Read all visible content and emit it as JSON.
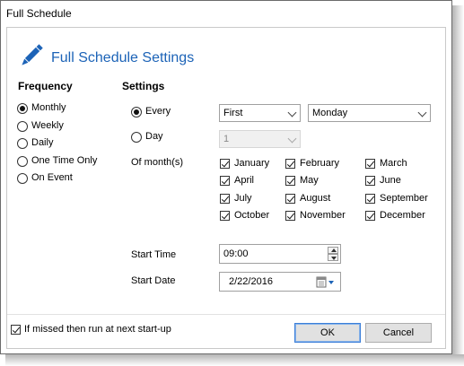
{
  "window": {
    "title": "Full Schedule"
  },
  "header": {
    "title": "Full Schedule Settings",
    "icon": "pencil-icon",
    "accent_color": "#1c63b7"
  },
  "frequency": {
    "heading": "Frequency",
    "selected": "Monthly",
    "options": [
      "Monthly",
      "Weekly",
      "Daily",
      "One Time Only",
      "On Event"
    ]
  },
  "settings": {
    "heading": "Settings",
    "every_label": "Every",
    "every_selected": true,
    "every_ordinal": "First",
    "every_weekday": "Monday",
    "day_label": "Day",
    "day_value": "1",
    "months_label": "Of month(s)",
    "months": [
      {
        "name": "January",
        "checked": true
      },
      {
        "name": "February",
        "checked": true
      },
      {
        "name": "March",
        "checked": true
      },
      {
        "name": "April",
        "checked": true
      },
      {
        "name": "May",
        "checked": true
      },
      {
        "name": "June",
        "checked": true
      },
      {
        "name": "July",
        "checked": true
      },
      {
        "name": "August",
        "checked": true
      },
      {
        "name": "September",
        "checked": true
      },
      {
        "name": "October",
        "checked": true
      },
      {
        "name": "November",
        "checked": true
      },
      {
        "name": "December",
        "checked": true
      }
    ],
    "start_time_label": "Start Time",
    "start_time": "09:00",
    "start_date_label": "Start Date",
    "start_date": "2/22/2016"
  },
  "footer": {
    "missed_label": "If missed then run at next start-up",
    "missed_checked": true,
    "ok_label": "OK",
    "cancel_label": "Cancel"
  }
}
